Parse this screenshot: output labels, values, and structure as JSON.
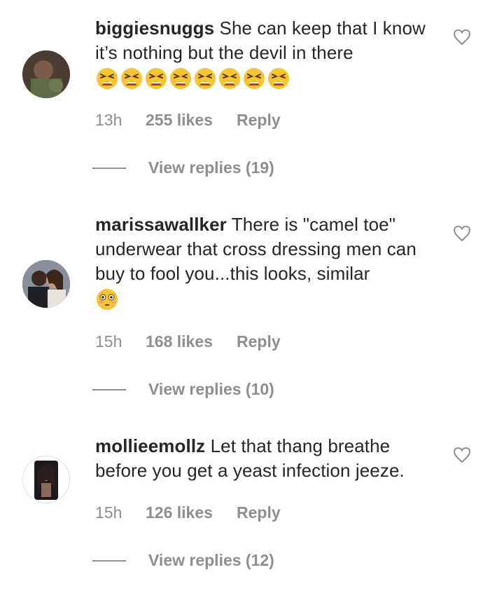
{
  "comments": [
    {
      "username": "biggiesnuggs",
      "text": "She can keep that I know it’s nothing but the devil in there",
      "emoji": [
        "tired-face-emoji",
        "tired-face-emoji",
        "tired-face-emoji",
        "tired-face-emoji",
        "tired-face-emoji",
        "tired-face-emoji",
        "tired-face-emoji",
        "tired-face-emoji"
      ],
      "time": "13h",
      "likes": "255 likes",
      "reply_label": "Reply",
      "view_replies": "View replies (19)"
    },
    {
      "username": "marissawallker",
      "text": "There is \"camel toe\" underwear that cross dressing men can buy to fool you...this looks, similar",
      "emoji": [
        "flushed-face-emoji"
      ],
      "time": "15h",
      "likes": "168 likes",
      "reply_label": "Reply",
      "view_replies": "View replies (10)"
    },
    {
      "username": "mollieemollz",
      "text": "Let that thang breathe before you get a yeast infection jeeze.",
      "emoji": [],
      "time": "15h",
      "likes": "126 likes",
      "reply_label": "Reply",
      "view_replies": "View replies (12)"
    }
  ],
  "colors": {
    "text": "#262626",
    "secondary": "#8e8e8e",
    "emoji_yellow": "#f7c531"
  }
}
